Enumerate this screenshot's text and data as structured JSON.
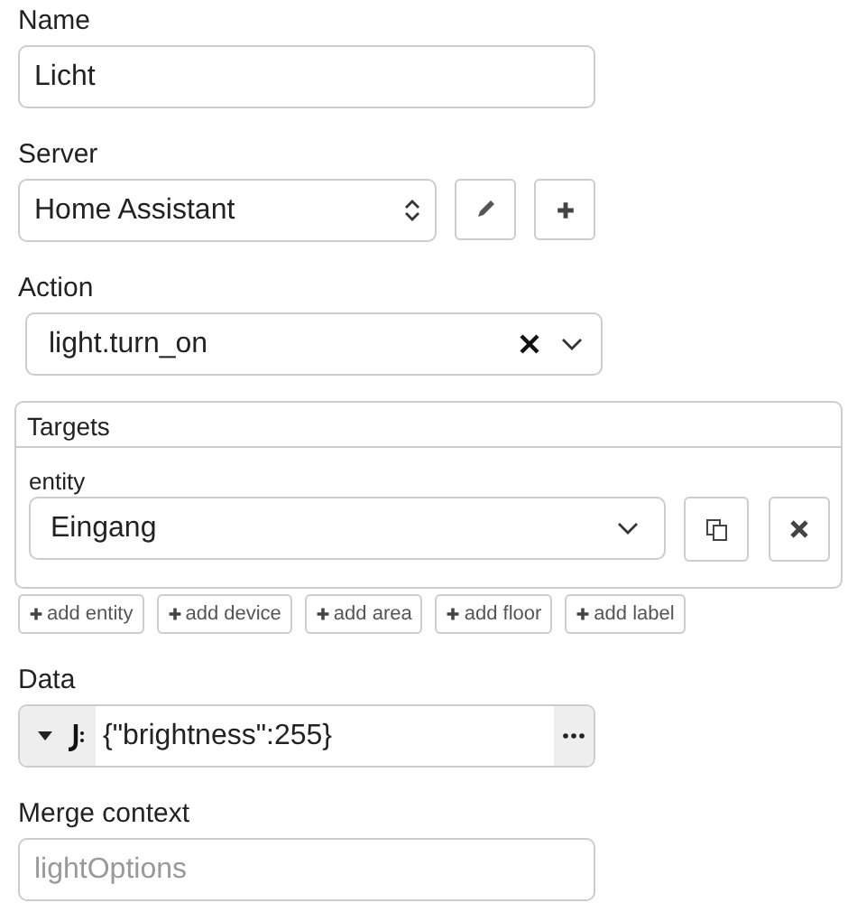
{
  "name": {
    "label": "Name",
    "value": "Licht"
  },
  "server": {
    "label": "Server",
    "value": "Home Assistant"
  },
  "action": {
    "label": "Action",
    "value": "light.turn_on"
  },
  "targets": {
    "title": "Targets",
    "entity_label": "entity",
    "entity_value": "Eingang",
    "add_buttons": [
      "add entity",
      "add device",
      "add area",
      "add floor",
      "add label"
    ]
  },
  "data": {
    "label": "Data",
    "value": "{\"brightness\":255}"
  },
  "merge_context": {
    "label": "Merge context",
    "placeholder": "lightOptions"
  }
}
